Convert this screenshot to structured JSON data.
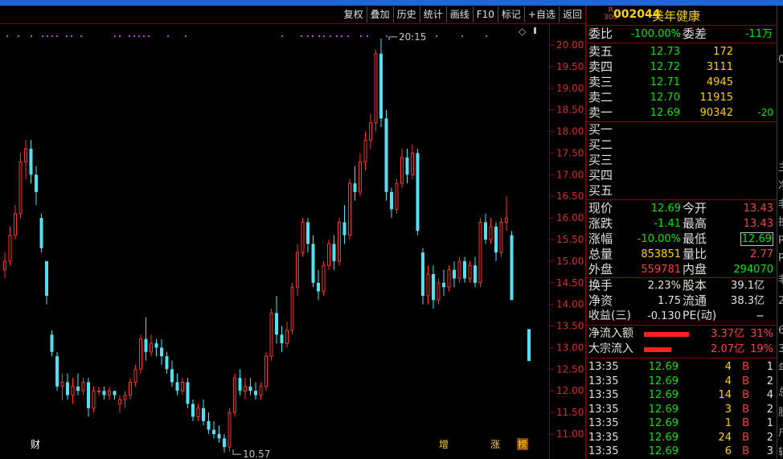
{
  "toolbar": {
    "buttons": [
      "复权",
      "叠加",
      "历史",
      "统计",
      "画线",
      "F10",
      "标记",
      "+自选",
      "返回"
    ]
  },
  "stock": {
    "badge_top": "R",
    "badge_bottom": "300",
    "code": "002044",
    "name": "美年健康"
  },
  "order_book": {
    "weibi_label": "委比",
    "weibi_value": "-100.00%",
    "weicha_label": "委差",
    "weicha_value": "-11万",
    "asks": [
      {
        "label": "卖五",
        "price": "12.73",
        "volume": "172",
        "extra": ""
      },
      {
        "label": "卖四",
        "price": "12.72",
        "volume": "3111",
        "extra": ""
      },
      {
        "label": "卖三",
        "price": "12.71",
        "volume": "4945",
        "extra": ""
      },
      {
        "label": "卖二",
        "price": "12.70",
        "volume": "11915",
        "extra": ""
      },
      {
        "label": "卖一",
        "price": "12.69",
        "volume": "90342",
        "extra": "-20"
      }
    ],
    "bids": [
      {
        "label": "买一"
      },
      {
        "label": "买二"
      },
      {
        "label": "买三"
      },
      {
        "label": "买四"
      },
      {
        "label": "买五"
      }
    ]
  },
  "quote": {
    "xianjia_label": "现价",
    "xianjia": "12.69",
    "jinkai_label": "今开",
    "jinkai": "13.43",
    "zhangdie_label": "涨跌",
    "zhangdie": "-1.41",
    "zuigao_label": "最高",
    "zuigao": "13.43",
    "zhangfu_label": "涨幅",
    "zhangfu": "-10.00%",
    "zuidi_label": "最低",
    "zuidi": "12.69",
    "zongliang_label": "总量",
    "zongliang": "853851",
    "liangbi_label": "量比",
    "liangbi": "2.77",
    "waipan_label": "外盘",
    "waipan": "559781",
    "neipan_label": "内盘",
    "neipan": "294070"
  },
  "fundamentals": {
    "huanshou_label": "换手",
    "huanshou": "2.23%",
    "guben_label": "股本",
    "guben": "39.1亿",
    "jingzi_label": "净资",
    "jingzi": "1.75",
    "liutong_label": "流通",
    "liutong": "38.3亿",
    "shouyi_label": "收益(三)",
    "shouyi": "-0.130",
    "pe_label": "PE(动)",
    "pe": "−"
  },
  "flows": [
    {
      "label": "净流入额",
      "amount": "3.37亿",
      "pct": "31%",
      "bar_fraction": 0.31
    },
    {
      "label": "大宗流入",
      "amount": "2.07亿",
      "pct": "19%",
      "bar_fraction": 0.19
    }
  ],
  "ticks": [
    {
      "time": "13:35",
      "price": "12.69",
      "vol": "4",
      "side": "B",
      "n": "1"
    },
    {
      "time": "13:35",
      "price": "12.69",
      "vol": "4",
      "side": "B",
      "n": "2"
    },
    {
      "time": "13:35",
      "price": "12.69",
      "vol": "14",
      "side": "B",
      "n": "4"
    },
    {
      "time": "13:35",
      "price": "12.69",
      "vol": "3",
      "side": "B",
      "n": "2"
    },
    {
      "time": "13:35",
      "price": "12.69",
      "vol": "1",
      "side": "B",
      "n": "1"
    },
    {
      "time": "13:35",
      "price": "12.69",
      "vol": "24",
      "side": "B",
      "n": "2"
    },
    {
      "time": "13:35",
      "price": "12.69",
      "vol": "6",
      "side": "B",
      "n": "3"
    }
  ],
  "side_strip_text": [
    "0",
    "主",
    "净",
    "非",
    "换",
    "P",
    "P",
    "非",
    "2",
    "6",
    "3",
    "年",
    "总",
    "股",
    "户",
    "转"
  ],
  "chart_markers": {
    "high_label": "20.15",
    "low_label": "10.57",
    "bottom_marks": [
      "财",
      "增",
      "涨",
      "榜"
    ],
    "diamond": "◇"
  },
  "chart_data": {
    "type": "candlestick",
    "y_ticks": [
      "20.00",
      "19.50",
      "19.00",
      "18.50",
      "18.00",
      "17.50",
      "17.00",
      "16.50",
      "16.00",
      "15.50",
      "15.00",
      "14.50",
      "14.00",
      "13.50",
      "13.00",
      "12.50",
      "12.00",
      "11.50",
      "11.00"
    ],
    "ylim": [
      10.5,
      20.4
    ],
    "up_color": "#ff3030",
    "down_color": "#54e0f0",
    "candles": [
      [
        14.8,
        15.2,
        14.6,
        15.0
      ],
      [
        15.0,
        15.8,
        14.9,
        15.6
      ],
      [
        15.6,
        16.3,
        15.5,
        16.1
      ],
      [
        16.1,
        17.5,
        16.0,
        17.3
      ],
      [
        17.3,
        17.8,
        16.9,
        17.6
      ],
      [
        17.6,
        17.8,
        16.8,
        17.0
      ],
      [
        17.0,
        17.2,
        16.3,
        16.6
      ],
      [
        16.0,
        16.1,
        15.2,
        15.3
      ],
      [
        15.0,
        15.0,
        14.0,
        14.2
      ],
      [
        13.3,
        13.4,
        12.8,
        12.9
      ],
      [
        12.8,
        12.9,
        12.0,
        12.1
      ],
      [
        12.1,
        12.4,
        11.8,
        12.2
      ],
      [
        12.2,
        12.4,
        11.8,
        11.9
      ],
      [
        11.9,
        12.3,
        11.7,
        12.1
      ],
      [
        12.1,
        12.4,
        11.9,
        12.0
      ],
      [
        12.0,
        12.3,
        11.9,
        12.2
      ],
      [
        12.2,
        12.3,
        11.4,
        11.6
      ],
      [
        11.6,
        12.1,
        11.5,
        12.0
      ],
      [
        12.0,
        12.1,
        11.9,
        12.0
      ],
      [
        12.0,
        12.1,
        11.8,
        11.9
      ],
      [
        11.9,
        12.1,
        11.8,
        12.0
      ],
      [
        12.0,
        12.0,
        11.8,
        11.9
      ],
      [
        11.7,
        11.9,
        11.5,
        11.8
      ],
      [
        11.8,
        12.0,
        11.6,
        11.9
      ],
      [
        11.9,
        12.3,
        11.8,
        12.2
      ],
      [
        12.2,
        12.6,
        12.1,
        12.5
      ],
      [
        12.5,
        13.3,
        12.4,
        13.2
      ],
      [
        13.2,
        13.7,
        12.7,
        12.9
      ],
      [
        12.9,
        13.3,
        12.8,
        13.1
      ],
      [
        13.1,
        13.2,
        12.8,
        13.0
      ],
      [
        13.0,
        13.2,
        12.6,
        12.8
      ],
      [
        12.8,
        12.9,
        12.4,
        12.5
      ],
      [
        12.5,
        12.7,
        12.1,
        12.2
      ],
      [
        12.2,
        12.4,
        11.9,
        12.0
      ],
      [
        12.0,
        12.3,
        11.9,
        12.2
      ],
      [
        12.2,
        12.3,
        11.6,
        11.7
      ],
      [
        11.7,
        11.8,
        11.3,
        11.4
      ],
      [
        11.4,
        11.7,
        11.3,
        11.6
      ],
      [
        11.6,
        11.8,
        11.2,
        11.3
      ],
      [
        11.3,
        11.5,
        11.0,
        11.1
      ],
      [
        11.1,
        11.3,
        10.9,
        11.0
      ],
      [
        11.0,
        11.2,
        10.8,
        10.9
      ],
      [
        10.9,
        11.0,
        10.57,
        10.7
      ],
      [
        10.7,
        11.6,
        10.6,
        11.5
      ],
      [
        11.5,
        12.4,
        11.4,
        12.3
      ],
      [
        12.3,
        12.5,
        11.9,
        12.0
      ],
      [
        12.0,
        12.3,
        11.8,
        12.1
      ],
      [
        12.1,
        12.3,
        11.9,
        12.0
      ],
      [
        12.0,
        12.2,
        11.8,
        11.9
      ],
      [
        11.9,
        12.2,
        11.8,
        12.1
      ],
      [
        12.1,
        12.9,
        12.0,
        12.8
      ],
      [
        12.8,
        13.9,
        12.7,
        13.8
      ],
      [
        13.8,
        14.2,
        13.1,
        13.3
      ],
      [
        13.3,
        13.5,
        12.9,
        13.1
      ],
      [
        13.1,
        13.6,
        13.0,
        13.4
      ],
      [
        13.4,
        14.5,
        13.3,
        14.4
      ],
      [
        14.4,
        15.4,
        14.2,
        15.2
      ],
      [
        15.2,
        16.0,
        15.1,
        15.9
      ],
      [
        15.9,
        16.0,
        15.2,
        15.4
      ],
      [
        15.4,
        15.6,
        14.4,
        14.5
      ],
      [
        14.5,
        14.8,
        14.1,
        14.3
      ],
      [
        14.3,
        15.0,
        14.2,
        14.9
      ],
      [
        14.9,
        15.5,
        14.8,
        15.4
      ],
      [
        15.4,
        15.6,
        14.8,
        15.0
      ],
      [
        15.0,
        16.0,
        14.9,
        15.9
      ],
      [
        15.9,
        16.3,
        15.4,
        15.6
      ],
      [
        15.6,
        16.9,
        15.5,
        16.8
      ],
      [
        16.8,
        17.2,
        16.4,
        16.6
      ],
      [
        16.6,
        17.5,
        16.5,
        17.3
      ],
      [
        17.3,
        18.0,
        17.1,
        17.8
      ],
      [
        17.8,
        18.4,
        17.6,
        18.2
      ],
      [
        18.2,
        19.9,
        18.0,
        19.8
      ],
      [
        19.8,
        20.15,
        18.1,
        18.3
      ],
      [
        18.3,
        18.5,
        16.4,
        16.6
      ],
      [
        16.6,
        16.7,
        16.0,
        16.2
      ],
      [
        16.2,
        16.9,
        16.1,
        16.8
      ],
      [
        16.8,
        17.6,
        16.7,
        17.4
      ],
      [
        17.4,
        17.6,
        16.8,
        17.0
      ],
      [
        17.0,
        17.7,
        16.9,
        17.5
      ],
      [
        17.5,
        17.6,
        15.6,
        15.7
      ],
      [
        15.2,
        15.3,
        14.0,
        14.2
      ],
      [
        14.2,
        14.9,
        14.0,
        14.7
      ],
      [
        14.7,
        14.9,
        13.9,
        14.1
      ],
      [
        14.1,
        14.6,
        14.0,
        14.5
      ],
      [
        14.5,
        14.8,
        14.2,
        14.4
      ],
      [
        14.4,
        14.9,
        14.3,
        14.8
      ],
      [
        14.8,
        15.0,
        14.4,
        14.6
      ],
      [
        14.6,
        15.1,
        14.5,
        15.0
      ],
      [
        15.0,
        15.1,
        14.5,
        14.6
      ],
      [
        14.6,
        15.0,
        14.5,
        14.9
      ],
      [
        14.9,
        15.1,
        14.4,
        14.5
      ],
      [
        14.5,
        16.0,
        14.4,
        15.9
      ],
      [
        15.9,
        16.1,
        15.4,
        15.5
      ],
      [
        15.5,
        16.0,
        15.4,
        15.8
      ],
      [
        15.8,
        15.9,
        15.0,
        15.2
      ],
      [
        15.2,
        16.0,
        15.1,
        15.9
      ],
      [
        15.9,
        16.5,
        15.7,
        16.0
      ],
      [
        15.6,
        15.7,
        14.1,
        14.1
      ],
      [
        13.43,
        13.43,
        12.69,
        12.69
      ]
    ]
  }
}
